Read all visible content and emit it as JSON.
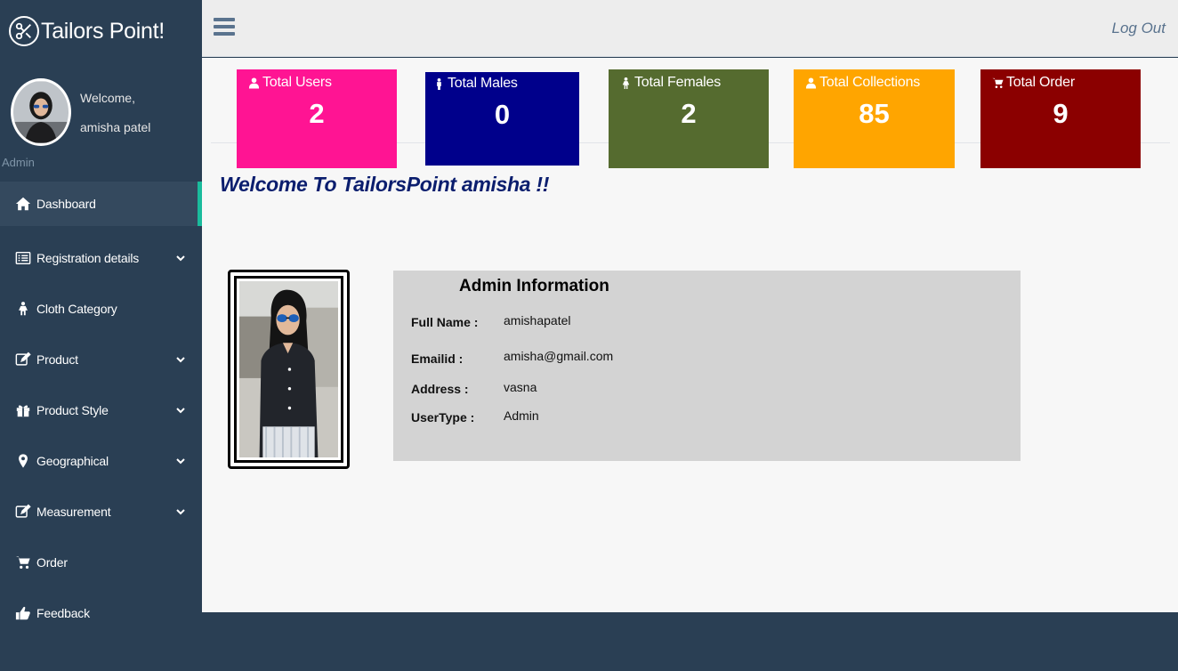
{
  "brand": {
    "title": "Tailors Point!",
    "logo_icon": "scissors-icon"
  },
  "profile": {
    "welcome": "Welcome,",
    "name": "amisha patel",
    "role": "Admin"
  },
  "menu": [
    {
      "label": "Dashboard",
      "icon": "home-icon",
      "active": true,
      "has_submenu": false
    },
    {
      "label": "Registration details",
      "icon": "list-icon",
      "has_submenu": true
    },
    {
      "label": "Cloth Category",
      "icon": "female-icon",
      "has_submenu": false
    },
    {
      "label": "Product",
      "icon": "edit-icon",
      "has_submenu": true
    },
    {
      "label": "Product Style",
      "icon": "gift-icon",
      "has_submenu": true
    },
    {
      "label": "Geographical",
      "icon": "map-marker-icon",
      "has_submenu": true
    },
    {
      "label": "Measurement",
      "icon": "edit-icon",
      "has_submenu": true
    },
    {
      "label": "Order",
      "icon": "cart-icon",
      "has_submenu": false
    },
    {
      "label": "Feedback",
      "icon": "thumbs-up-icon",
      "has_submenu": false
    }
  ],
  "topbar": {
    "logout": "Log Out"
  },
  "stats": [
    {
      "label": "Total Users",
      "value": "2",
      "color": "#ff1493",
      "icon": "user-icon"
    },
    {
      "label": "Total Males",
      "value": "0",
      "color": "#00008b",
      "icon": "male-icon"
    },
    {
      "label": "Total Females",
      "value": "2",
      "color": "#556b2f",
      "icon": "female-icon"
    },
    {
      "label": "Total Collections",
      "value": "85",
      "color": "#ffa500",
      "icon": "user-icon"
    },
    {
      "label": "Total Order",
      "value": "9",
      "color": "#8b0000",
      "icon": "cart-icon"
    }
  ],
  "welcome_heading": "Welcome To TailorsPoint amisha !!",
  "admin_info": {
    "title": "Admin Information",
    "rows": [
      {
        "label": "Full Name :",
        "value": "amishapatel"
      },
      {
        "label": "Emailid :",
        "value": "amisha@gmail.com"
      },
      {
        "label": "Address :",
        "value": "vasna"
      },
      {
        "label": "UserType :",
        "value": "Admin"
      }
    ]
  },
  "colors": {
    "sidebar": "#2a3f54",
    "active_accent": "#1abb9c",
    "heading": "#0b1e6e"
  }
}
